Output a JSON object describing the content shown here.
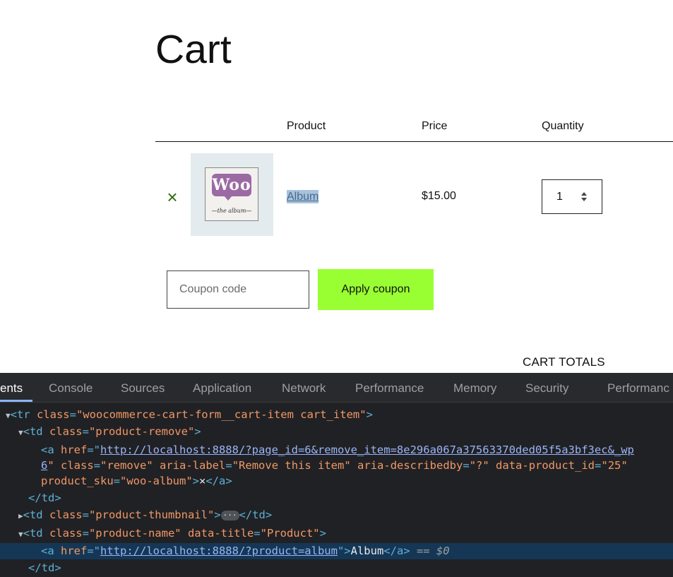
{
  "page": {
    "title": "Cart"
  },
  "table": {
    "headers": {
      "product": "Product",
      "price": "Price",
      "quantity": "Quantity"
    },
    "rows": [
      {
        "remove_glyph": "×",
        "thumbnail_logo": "Woo",
        "thumbnail_caption": "—the album—",
        "product_name": "Album",
        "price": "$15.00",
        "quantity": "1"
      }
    ]
  },
  "coupon": {
    "placeholder": "Coupon code",
    "apply_label": "Apply coupon"
  },
  "totals": {
    "heading": "CART TOTALS"
  },
  "devtools": {
    "tabs": [
      "ents",
      "Console",
      "Sources",
      "Application",
      "Network",
      "Performance",
      "Memory",
      "Security",
      "Performanc"
    ],
    "active_tab": "ents",
    "lines": {
      "l1_tag_open": "<tr ",
      "l1_attr": "class",
      "l1_val": "\"woocommerce-cart-form__cart-item cart_item\"",
      "l1_close": ">",
      "l2_tag": "<td ",
      "l2_attr": "class",
      "l2_val": "\"product-remove\"",
      "l2_close": ">",
      "l3_tag": "<a ",
      "l3_attr": "href",
      "l3_link": "http://localhost:8888/?page_id=6&remove_item=8e296a067a37563370ded05f5a3bf3ec&_wp",
      "l4_link": "6",
      "l4_rest_a": "\" ",
      "l4_attr1": "class",
      "l4_val1": "\"remove\"",
      "l4_attr2": "aria-label",
      "l4_val2": "\"Remove this item\"",
      "l4_attr3": "aria-describedby",
      "l4_val3": "\"?\"",
      "l4_attr4": "data-product_id",
      "l4_val4": "\"25\"",
      "l5_attr": "product_sku",
      "l5_val": "\"woo-album\"",
      "l5_text": "×",
      "l5_close": "</a>",
      "l6_close": "</td>",
      "l7_tag": "<td ",
      "l7_attr": "class",
      "l7_val": "\"product-thumbnail\"",
      "l7_ellipsis": "···",
      "l7_close": "</td>",
      "l8_tag": "<td ",
      "l8_attr1": "class",
      "l8_val1": "\"product-name\"",
      "l8_attr2": "data-title",
      "l8_val2": "\"Product\"",
      "l9_tag": "<a ",
      "l9_attr": "href",
      "l9_link": "http://localhost:8888/?product=album",
      "l9_text": "Album",
      "l9_close": "</a>",
      "l9_eq": " == ",
      "l9_dollar": "$0",
      "l10_close": "</td>"
    }
  }
}
